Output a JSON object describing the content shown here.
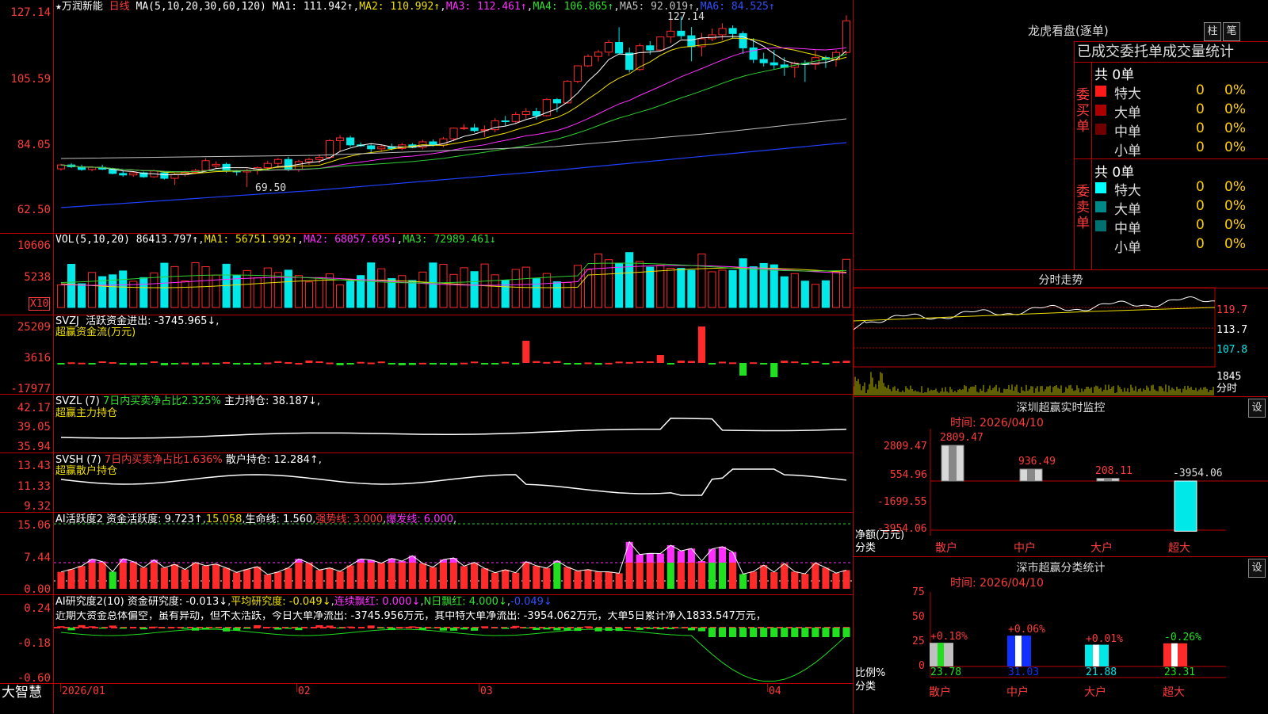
{
  "colors": {
    "up": "#ff2a2a",
    "down": "#00e8e8",
    "ma1": "#ffffff",
    "ma2": "#f0e000",
    "ma3": "#ff30ff",
    "ma4": "#30d030",
    "ma5": "#c0c0c0",
    "ma6": "#2040ff",
    "grid": "#b00000",
    "axis": "#ff3b3b"
  },
  "header": {
    "star": "★",
    "stock": "万润新能",
    "period": "日线",
    "ma_params": "MA(5,10,20,30,60,120)",
    "ma1": "MA1: 111.942↑",
    "ma2": "MA2: 110.992↑",
    "ma3": "MA3: 112.461↑",
    "ma4": "MA4: 106.865↑",
    "ma5": "MA5: 92.019↑",
    "ma6": "MA6: 84.525↑"
  },
  "axes": {
    "main": [
      "127.14",
      "105.59",
      "84.05",
      "62.50"
    ],
    "vol": [
      "10606",
      "5238"
    ],
    "vol_unit": "X10",
    "svzj": [
      "25209",
      "3616",
      "-17977"
    ],
    "svzl": [
      "42.17",
      "39.05",
      "35.94"
    ],
    "svsh": [
      "13.43",
      "11.33",
      "9.32"
    ],
    "ai": [
      "15.06",
      "7.44",
      "0.00"
    ],
    "yj": [
      "0.24",
      "-0.18",
      "-0.60"
    ]
  },
  "annotations": {
    "high": "127.14",
    "low": "69.50"
  },
  "vol_hdr": {
    "label": "VOL(5,10,20)",
    "val": "86413.797↑",
    "ma1": "MA1: 56751.992↑",
    "ma2": "MA2: 68057.695↓",
    "ma3": "MA3: 72989.461↓"
  },
  "svzj_hdr": {
    "label": "SVZJ",
    "t1": "活跃资金进出: -3745.965↓,",
    "t2": "超赢资金流(万元)"
  },
  "svzl_hdr": {
    "label": "SVZL (7)",
    "t1": "7日内买卖净占比2.325%",
    "t2": "主力持仓: 38.187↓,",
    "t3": "超赢主力持仓"
  },
  "svsh_hdr": {
    "label": "SVSH (7)",
    "t1": "7日内买卖净占比1.636%",
    "t2": "散户持仓: 12.284↑,",
    "t3": "超赢散户持仓"
  },
  "ai_hdr": {
    "label": "AI活跃度2",
    "t1": "资金活跃度: 9.723↑",
    "t2": "15.058",
    "t3": "生命线: 1.560",
    "t4": "强势线: 3.000",
    "t5": "爆发线: 6.000"
  },
  "yj_hdr": {
    "label": "AI研究度2(10)",
    "t1": "资金研究度: -0.013↓",
    "t2": "平均研究度: -0.049↓",
    "t3": "连续飘红: 0.000↓",
    "t4": "N日飘红: 4.000↓",
    "t5": "-0.049↓",
    "t6": "近期大资金总体偏空，虽有异动，但不太活跃，今日大单净流出: -3745.956万元，其中特大单净流出: -3954.062万元，大单5日累计净入1833.547万元，"
  },
  "xaxis": {
    "brand": "大智慧",
    "labels": [
      "2026/01",
      "02",
      "03",
      "04"
    ]
  },
  "lhb": {
    "title": "龙虎看盘(逐单)",
    "btn1": "柱",
    "btn2": "笔",
    "sub": "已成交委托单成交量统计",
    "buy": {
      "side": "委买单",
      "total": "共 0单",
      "rows": [
        {
          "n": "特大",
          "v": "0",
          "p": "0%"
        },
        {
          "n": "大单",
          "v": "0",
          "p": "0%"
        },
        {
          "n": "中单",
          "v": "0",
          "p": "0%"
        },
        {
          "n": "小单",
          "v": "0",
          "p": "0%"
        }
      ]
    },
    "sell": {
      "side": "委卖单",
      "total": "共 0单",
      "rows": [
        {
          "n": "特大",
          "v": "0",
          "p": "0%"
        },
        {
          "n": "大单",
          "v": "0",
          "p": "0%"
        },
        {
          "n": "中单",
          "v": "0",
          "p": "0%"
        },
        {
          "n": "小单",
          "v": "0",
          "p": "0%"
        }
      ]
    }
  },
  "intraday": {
    "title": "分时走势",
    "price_ticks": [
      "119.7",
      "113.7",
      "107.8"
    ],
    "vol_tick": "1845",
    "unit": "分时"
  },
  "monitor": {
    "title": "深圳超赢实时监控",
    "btn": "设",
    "time": "时间: 2026/04/10",
    "ylab": "净额(万元)",
    "cat_lab": "分类",
    "ticks": [
      "2809.47",
      "554.96",
      "-1699.55",
      "-3954.06"
    ],
    "bars": [
      {
        "cat": "散户",
        "v": "2809.47"
      },
      {
        "cat": "中户",
        "v": "936.49"
      },
      {
        "cat": "大户",
        "v": "208.11"
      },
      {
        "cat": "超大",
        "v": "-3954.06"
      }
    ]
  },
  "classify": {
    "title": "深市超赢分类统计",
    "btn": "设",
    "time": "时间: 2026/04/10",
    "ylab": "比例%",
    "cat_lab": "分类",
    "ticks": [
      "75",
      "50",
      "25",
      "0"
    ],
    "bars": [
      {
        "cat": "散户",
        "top": "+0.18%",
        "val": "23.78"
      },
      {
        "cat": "中户",
        "top": "+0.06%",
        "val": "31.03"
      },
      {
        "cat": "大户",
        "top": "+0.01%",
        "val": "21.88"
      },
      {
        "cat": "超大",
        "top": "-0.26%",
        "val": "23.31"
      }
    ]
  },
  "chart_data": {
    "type": "candlestick",
    "ylim": [
      62.5,
      127.14
    ],
    "candles": [
      [
        75.5,
        77.2,
        74.9,
        76.8
      ],
      [
        76.8,
        77.4,
        75.8,
        76.2
      ],
      [
        76.2,
        76.9,
        74.9,
        75.3
      ],
      [
        75.3,
        76.4,
        74.7,
        76.0
      ],
      [
        76.0,
        76.9,
        75.1,
        75.4
      ],
      [
        75.4,
        75.9,
        73.7,
        74.0
      ],
      [
        74.0,
        74.8,
        72.9,
        73.5
      ],
      [
        73.5,
        74.6,
        72.9,
        74.2
      ],
      [
        74.2,
        74.6,
        72.6,
        72.9
      ],
      [
        72.9,
        75.2,
        72.6,
        74.8
      ],
      [
        74.2,
        74.8,
        72.0,
        72.4
      ],
      [
        72.4,
        74.0,
        70.2,
        73.6
      ],
      [
        73.6,
        74.9,
        73.0,
        74.4
      ],
      [
        74.4,
        75.5,
        73.9,
        75.0
      ],
      [
        75.0,
        79.0,
        74.9,
        78.2
      ],
      [
        76.5,
        78.0,
        75.5,
        77.0
      ],
      [
        77.0,
        77.6,
        74.2,
        74.8
      ],
      [
        74.8,
        75.2,
        73.3,
        74.5
      ],
      [
        74.5,
        75.6,
        69.5,
        74.9
      ],
      [
        74.9,
        76.3,
        73.6,
        75.9
      ],
      [
        75.9,
        78.2,
        75.1,
        77.3
      ],
      [
        77.3,
        79.1,
        75.8,
        78.6
      ],
      [
        78.6,
        79.5,
        74.7,
        75.3
      ],
      [
        75.3,
        78.5,
        74.5,
        77.9
      ],
      [
        77.9,
        79.2,
        76.8,
        78.6
      ],
      [
        78.6,
        80.3,
        77.3,
        79.3
      ],
      [
        79.3,
        85.3,
        78.6,
        84.8
      ],
      [
        84.8,
        86.6,
        81.4,
        85.7
      ],
      [
        85.7,
        86.4,
        82.8,
        83.4
      ],
      [
        83.4,
        84.2,
        82.7,
        83.1
      ],
      [
        83.1,
        83.9,
        80.7,
        82.1
      ],
      [
        82.1,
        83.5,
        81.1,
        82.8
      ],
      [
        82.8,
        83.8,
        81.6,
        82.2
      ],
      [
        82.2,
        84.0,
        81.7,
        83.4
      ],
      [
        83.4,
        84.0,
        82.3,
        82.6
      ],
      [
        82.6,
        85.1,
        81.9,
        84.4
      ],
      [
        84.4,
        85.2,
        82.9,
        83.3
      ],
      [
        83.3,
        86.0,
        82.6,
        85.4
      ],
      [
        85.4,
        89.1,
        84.6,
        88.9
      ],
      [
        88.9,
        90.2,
        88.3,
        89.0
      ],
      [
        89.0,
        90.3,
        87.5,
        88.1
      ],
      [
        88.1,
        89.8,
        86.0,
        88.4
      ],
      [
        88.4,
        92.2,
        87.5,
        91.3
      ],
      [
        91.3,
        92.9,
        89.7,
        91.1
      ],
      [
        91.1,
        94.2,
        90.3,
        93.4
      ],
      [
        93.4,
        95.5,
        92.0,
        94.4
      ],
      [
        94.4,
        95.6,
        91.8,
        93.0
      ],
      [
        93.0,
        98.8,
        92.7,
        98.3
      ],
      [
        98.3,
        98.8,
        94.2,
        97.2
      ],
      [
        97.2,
        104.7,
        96.9,
        104.3
      ],
      [
        104.3,
        109.5,
        103.7,
        109.4
      ],
      [
        109.4,
        113.2,
        109.0,
        112.5
      ],
      [
        112.5,
        114.6,
        110.8,
        113.9
      ],
      [
        113.9,
        118.0,
        112.6,
        117.1
      ],
      [
        117.1,
        122.1,
        113.5,
        113.6
      ],
      [
        113.6,
        115.4,
        107.2,
        108.2
      ],
      [
        108.2,
        116.8,
        107.7,
        116.0
      ],
      [
        116.0,
        117.5,
        113.1,
        114.6
      ],
      [
        114.6,
        119.0,
        114.4,
        118.9
      ],
      [
        118.9,
        127.1,
        116.8,
        120.8
      ],
      [
        120.8,
        125.7,
        118.3,
        119.3
      ],
      [
        119.3,
        122.2,
        110.9,
        115.7
      ],
      [
        115.7,
        120.2,
        112.5,
        118.3
      ],
      [
        118.3,
        121.6,
        117.5,
        119.6
      ],
      [
        119.6,
        123.4,
        117.8,
        121.7
      ],
      [
        121.7,
        122.7,
        118.5,
        120.0
      ],
      [
        120.0,
        120.8,
        113.3,
        115.3
      ],
      [
        115.3,
        118.5,
        110.3,
        111.5
      ],
      [
        111.5,
        113.7,
        109.2,
        110.4
      ],
      [
        110.4,
        114.6,
        108.4,
        109.7
      ],
      [
        109.7,
        112.2,
        106.1,
        108.9
      ],
      [
        108.9,
        110.8,
        105.5,
        110.2
      ],
      [
        110.2,
        111.2,
        104.1,
        109.9
      ],
      [
        109.9,
        114.5,
        108.1,
        112.1
      ],
      [
        112.1,
        112.7,
        108.7,
        111.5
      ],
      [
        111.5,
        114.6,
        109.1,
        113.8
      ],
      [
        113.8,
        126.0,
        113.0,
        124.2
      ]
    ]
  }
}
